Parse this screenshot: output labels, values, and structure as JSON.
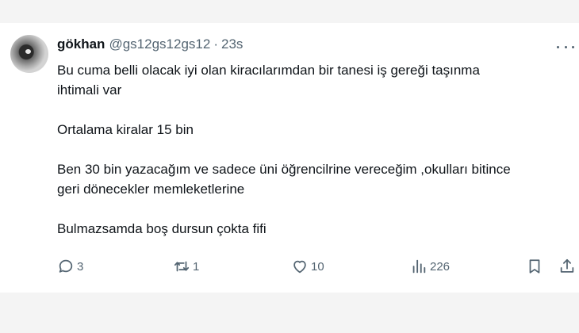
{
  "tweet": {
    "display_name": "gökhan",
    "handle": "@gs12gs12gs12",
    "separator": "·",
    "time": "23s",
    "lines": [
      "Bu cuma belli olacak iyi olan kiracılarımdan bir tanesi iş gereği taşınma",
      "ihtimali var",
      "",
      "Ortalama kiralar 15 bin",
      "",
      "Ben 30 bin yazacağım ve sadece üni öğrencilrine vereceğim ,okulları bitince",
      "geri dönecekler memleketlerine",
      "",
      "Bulmazsamda boş dursun çokta fifi"
    ]
  },
  "actions": {
    "reply_icon": "reply-icon",
    "reply_count": "3",
    "retweet_icon": "retweet-icon",
    "retweet_count": "1",
    "like_icon": "heart-icon",
    "like_count": "10",
    "views_icon": "views-chart-icon",
    "views_count": "226",
    "bookmark_icon": "bookmark-icon",
    "share_icon": "share-icon"
  },
  "colors": {
    "text": "#0f1419",
    "secondary": "#536471",
    "background": "#ffffff",
    "bands": "#f4f4f4"
  }
}
